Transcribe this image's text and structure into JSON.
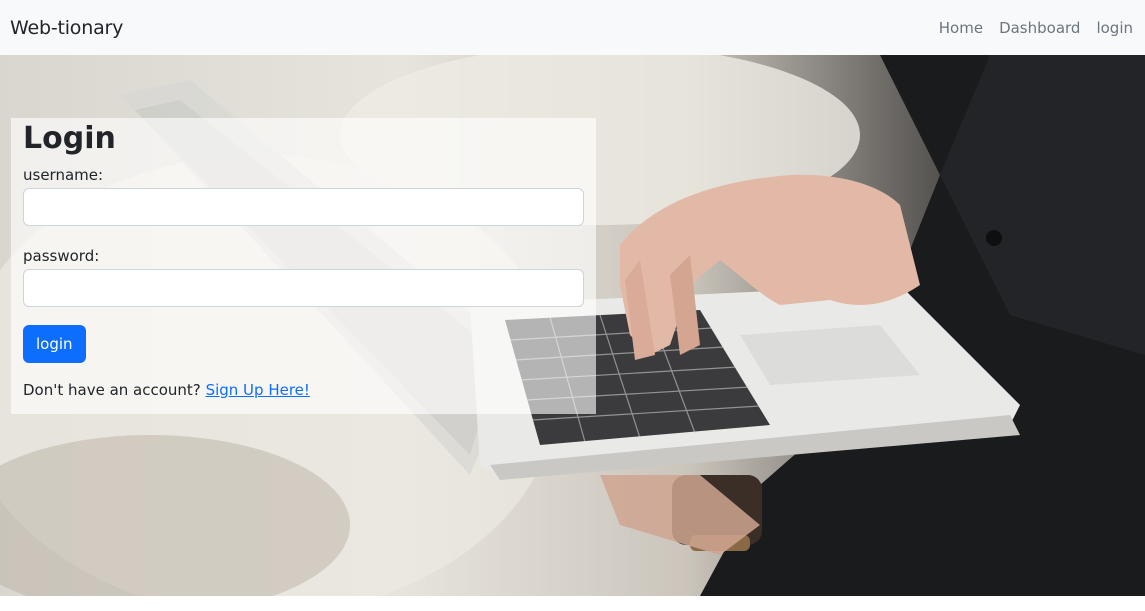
{
  "navbar": {
    "brand": "Web-tionary",
    "links": [
      "Home",
      "Dashboard",
      "login"
    ]
  },
  "login_form": {
    "title": "Login",
    "username_label": "username:",
    "username_value": "",
    "password_label": "password:",
    "password_value": "",
    "submit_label": "login",
    "signup_prompt": "Don't have an account?",
    "signup_link": "Sign Up Here!"
  },
  "colors": {
    "navbar_bg": "#f8f9fa",
    "primary": "#0d6efd",
    "link": "#0d6efd"
  }
}
